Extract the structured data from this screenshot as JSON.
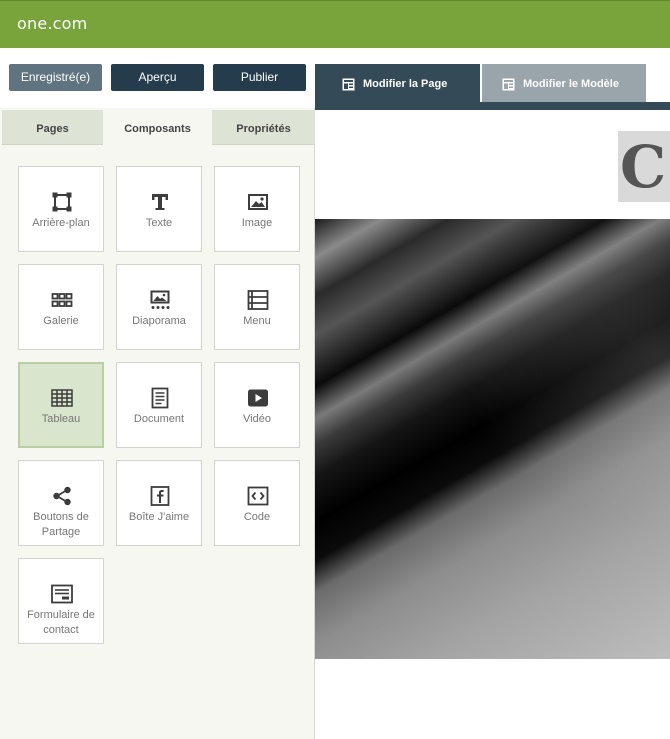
{
  "app": {
    "logo": "one.com"
  },
  "toolbar": {
    "saved_label": "Enregistré(e)",
    "preview_label": "Aperçu",
    "publish_label": "Publier"
  },
  "mode_tabs": {
    "edit_page": "Modifier la Page",
    "edit_template": "Modifier le Modèle"
  },
  "sidebar": {
    "tabs": {
      "pages": "Pages",
      "components": "Composants",
      "properties": "Propriétés"
    },
    "components": [
      {
        "label": "Arrière-plan",
        "icon": "background-crop-icon"
      },
      {
        "label": "Texte",
        "icon": "text-icon"
      },
      {
        "label": "Image",
        "icon": "image-icon"
      },
      {
        "label": "Galerie",
        "icon": "gallery-grid-icon"
      },
      {
        "label": "Diaporama",
        "icon": "slideshow-icon"
      },
      {
        "label": "Menu",
        "icon": "menu-list-icon"
      },
      {
        "label": "Tableau",
        "icon": "table-icon",
        "active": true
      },
      {
        "label": "Document",
        "icon": "document-icon"
      },
      {
        "label": "Vidéo",
        "icon": "video-play-icon"
      },
      {
        "label": "Boutons de Partage",
        "icon": "share-icon"
      },
      {
        "label": "Boîte J'aime",
        "icon": "facebook-icon"
      },
      {
        "label": "Code",
        "icon": "code-icon"
      },
      {
        "label": "Formulaire de contact",
        "icon": "contact-form-icon"
      }
    ]
  },
  "canvas": {
    "logo_text": "C"
  },
  "colors": {
    "topbar": "#79a43c",
    "button_dark": "#243c4c",
    "button_saved": "#5f7480",
    "tab_active": "#344b57",
    "tab_inactive": "#99a4ab",
    "tile_active": "#d9e5cd"
  }
}
